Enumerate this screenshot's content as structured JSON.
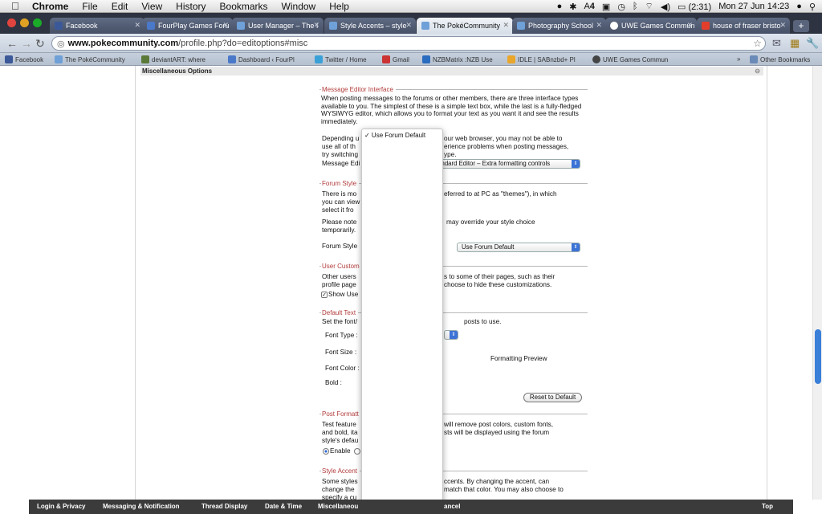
{
  "menubar": {
    "items": [
      "Chrome",
      "File",
      "Edit",
      "View",
      "History",
      "Bookmarks",
      "Window",
      "Help"
    ],
    "status": {
      "battery": "(2:31)",
      "clock": "Mon 27 Jun  14:23",
      "badge": "4"
    }
  },
  "tabs": [
    {
      "title": "Facebook",
      "color": "#3b5998"
    },
    {
      "title": "FourPlay Games Foru",
      "color": "#4a79c9"
    },
    {
      "title": "User Manager – The I",
      "color": "#6fa0d8"
    },
    {
      "title": "Style Accents – style",
      "color": "#6fa0d8"
    },
    {
      "title": "The PokéCommunity",
      "color": "#6fa0d8",
      "active": true
    },
    {
      "title": "Photography School",
      "color": "#6fa0d8"
    },
    {
      "title": "UWE Games Commun",
      "color": "#ffffff"
    },
    {
      "title": "house of fraser bristo",
      "color": "#e33e2b"
    }
  ],
  "address": {
    "domain": "www.pokecommunity.com",
    "path": "/profile.php?do=editoptions#misc"
  },
  "bookmarks": [
    {
      "label": "Facebook",
      "color": "#3b5998"
    },
    {
      "label": "The PokéCommunity",
      "color": "#6fa0d8"
    },
    {
      "label": "deviantART: where",
      "color": "#5b7a3a"
    },
    {
      "label": "Dashboard ‹ FourPl",
      "color": "#4a79c9"
    },
    {
      "label": "Twitter / Home",
      "color": "#3aa0d8"
    },
    {
      "label": "Gmail",
      "color": "#c33"
    },
    {
      "label": "NZBMatrix :NZB Use",
      "color": "#2a6cbf"
    },
    {
      "label": "IDLE | SABnzbd+ Pl",
      "color": "#e9a62b"
    },
    {
      "label": "UWE Games Commun",
      "color": "#444"
    }
  ],
  "other_bookmarks": "Other Bookmarks",
  "section_title": "Miscellaneous Options",
  "message_editor": {
    "legend": "Message Editor Interface",
    "p1": "When posting messages to the forums or other members, there are three interface types available to you. The simplest of these is a simple text box, while the last is a fully-fledged WYSIWYG editor, which allows you to format your text as you want it and see the results immediately.",
    "p2a": "Depending u",
    "p2b": "our web browser, you may not be able to",
    "p2c": "use all of th",
    "p2d": "erience problems when posting messages,",
    "p2e": "try switching",
    "p2f": "ype.",
    "label": "Message Edi",
    "select_value": "tandard Editor – Extra formatting controls"
  },
  "forum_style": {
    "legend": "Forum Style",
    "p1a": "There is mo",
    "p1b": "eferred to at PC as \"themes\"), in which",
    "p1c": "you can view",
    "p1d": "select it fro",
    "p2a": "Please note",
    "p2b": "may override your style choice",
    "p2c": "temporarily.",
    "label": "Forum Style",
    "select_value": "Use Forum Default"
  },
  "user_custom": {
    "legend": "User Custom",
    "p1a": "Other users",
    "p1b": "s to some of their pages, such as their",
    "p1c": "profile page",
    "p1d": "choose to hide these customizations.",
    "check_label": "Show Use"
  },
  "default_text": {
    "legend": "Default Text",
    "p1a": "Set the font/",
    "p1b": "posts to use.",
    "font_type": "Font Type :",
    "font_size": "Font Size :",
    "font_color": "Font Color :",
    "bold": "Bold :",
    "preview": "Formatting Preview",
    "reset": "Reset to Default"
  },
  "post_format": {
    "legend": "Post Formatt",
    "p1a": "Test feature",
    "p1b": "will remove post colors, custom fonts,",
    "p1c": "and bold, ita",
    "p1d": "sts will be displayed using the forum",
    "p1e": "style's defau",
    "enable": "Enable"
  },
  "style_accent": {
    "legend": "Style Accent",
    "p1a": "Some styles",
    "p1b": "ccents. By changing the accent, can",
    "p1c": "change the",
    "p1d": "match that color. You may also choose to",
    "p1e": "specify a cu"
  },
  "dropdown": {
    "option": "✓ Use Forum Default"
  },
  "bottom_tabs": [
    "Login & Privacy",
    "Messaging & Notification",
    "Thread Display",
    "Date & Time",
    "Miscellaneou",
    "ancel",
    "Top"
  ]
}
